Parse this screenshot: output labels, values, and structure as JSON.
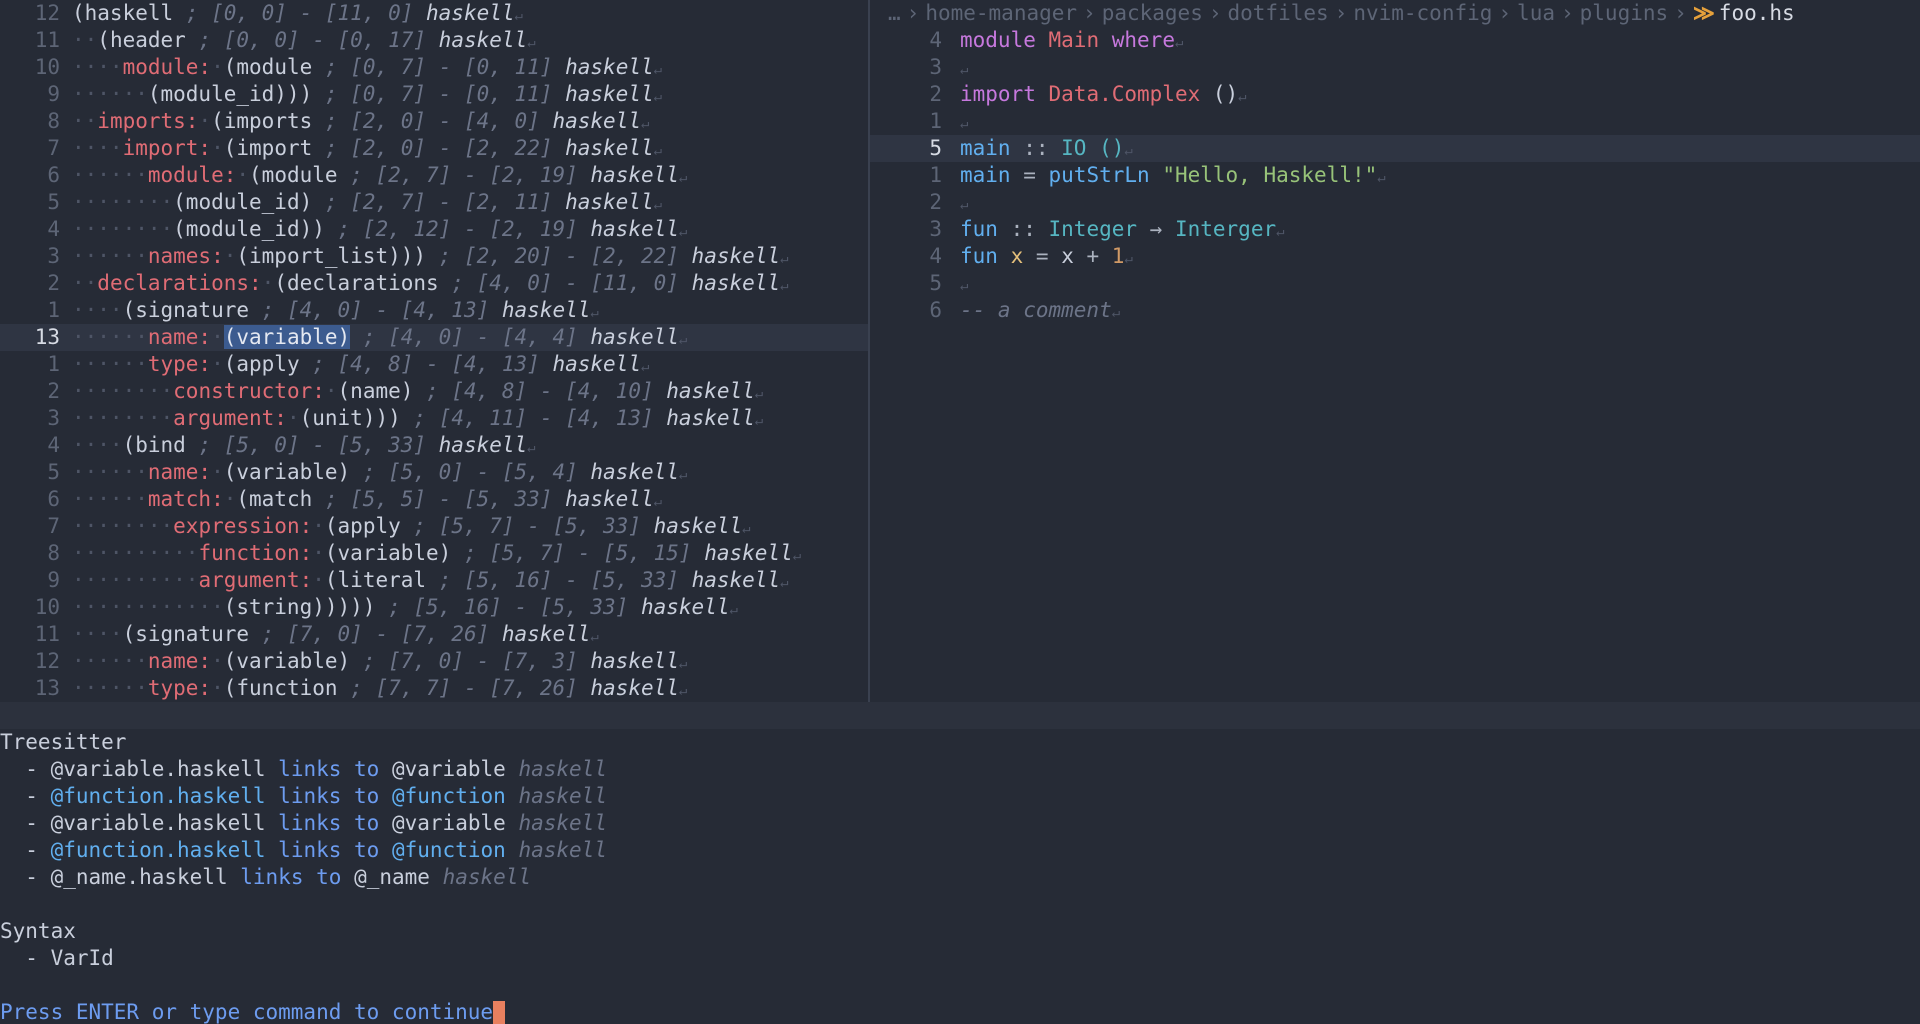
{
  "tree_lines": [
    {
      "num": "12",
      "lead": "",
      "field": "",
      "node": "(haskell",
      "range": " ; [0, 0] - [11, 0]",
      "lang": " haskell"
    },
    {
      "num": "11",
      "lead": "··",
      "field": "",
      "node": "(header",
      "range": " ; [0, 0] - [0, 17]",
      "lang": " haskell"
    },
    {
      "num": "10",
      "lead": "····",
      "field": "module: ",
      "node": "(module",
      "range": " ; [0, 7] - [0, 11]",
      "lang": " haskell"
    },
    {
      "num": "9",
      "lead": "······",
      "field": "",
      "node": "(module_id)))",
      "range": " ; [0, 7] - [0, 11]",
      "lang": " haskell"
    },
    {
      "num": "8",
      "lead": "··",
      "field": "imports: ",
      "node": "(imports",
      "range": " ; [2, 0] - [4, 0]",
      "lang": " haskell"
    },
    {
      "num": "7",
      "lead": "····",
      "field": "import: ",
      "node": "(import",
      "range": " ; [2, 0] - [2, 22]",
      "lang": " haskell"
    },
    {
      "num": "6",
      "lead": "······",
      "field": "module: ",
      "node": "(module",
      "range": " ; [2, 7] - [2, 19]",
      "lang": " haskell"
    },
    {
      "num": "5",
      "lead": "········",
      "field": "",
      "node": "(module_id)",
      "range": " ; [2, 7] - [2, 11]",
      "lang": " haskell"
    },
    {
      "num": "4",
      "lead": "········",
      "field": "",
      "node": "(module_id))",
      "range": " ; [2, 12] - [2, 19]",
      "lang": " haskell"
    },
    {
      "num": "3",
      "lead": "······",
      "field": "names: ",
      "node": "(import_list)))",
      "range": " ; [2, 20] - [2, 22]",
      "lang": " haskell"
    },
    {
      "num": "2",
      "lead": "··",
      "field": "declarations: ",
      "node": "(declarations",
      "range": " ; [4, 0] - [11, 0]",
      "lang": " haskell"
    },
    {
      "num": "1",
      "lead": "····",
      "field": "",
      "node": "(signature",
      "range": " ; [4, 0] - [4, 13]",
      "lang": " haskell"
    },
    {
      "num": "13",
      "lead": "······",
      "field": "name: ",
      "node": "(variable)",
      "range": " ; [4, 0] - [4, 4]",
      "lang": " haskell",
      "current": true
    },
    {
      "num": "1",
      "lead": "······",
      "field": "type: ",
      "node": "(apply",
      "range": " ; [4, 8] - [4, 13]",
      "lang": " haskell"
    },
    {
      "num": "2",
      "lead": "········",
      "field": "constructor: ",
      "node": "(name)",
      "range": " ; [4, 8] - [4, 10]",
      "lang": " haskell"
    },
    {
      "num": "3",
      "lead": "········",
      "field": "argument: ",
      "node": "(unit)))",
      "range": " ; [4, 11] - [4, 13]",
      "lang": " haskell"
    },
    {
      "num": "4",
      "lead": "····",
      "field": "",
      "node": "(bind",
      "range": " ; [5, 0] - [5, 33]",
      "lang": " haskell"
    },
    {
      "num": "5",
      "lead": "······",
      "field": "name: ",
      "node": "(variable)",
      "range": " ; [5, 0] - [5, 4]",
      "lang": " haskell"
    },
    {
      "num": "6",
      "lead": "······",
      "field": "match: ",
      "node": "(match",
      "range": " ; [5, 5] - [5, 33]",
      "lang": " haskell"
    },
    {
      "num": "7",
      "lead": "········",
      "field": "expression: ",
      "node": "(apply",
      "range": " ; [5, 7] - [5, 33]",
      "lang": " haskell"
    },
    {
      "num": "8",
      "lead": "··········",
      "field": "function: ",
      "node": "(variable)",
      "range": " ; [5, 7] - [5, 15]",
      "lang": " haskell"
    },
    {
      "num": "9",
      "lead": "··········",
      "field": "argument: ",
      "node": "(literal",
      "range": " ; [5, 16] - [5, 33]",
      "lang": " haskell"
    },
    {
      "num": "10",
      "lead": "············",
      "field": "",
      "node": "(string)))))",
      "range": " ; [5, 16] - [5, 33]",
      "lang": " haskell"
    },
    {
      "num": "11",
      "lead": "····",
      "field": "",
      "node": "(signature",
      "range": " ; [7, 0] - [7, 26]",
      "lang": " haskell"
    },
    {
      "num": "12",
      "lead": "······",
      "field": "name: ",
      "node": "(variable)",
      "range": " ; [7, 0] - [7, 3]",
      "lang": " haskell"
    },
    {
      "num": "13",
      "lead": "······",
      "field": "type: ",
      "node": "(function",
      "range": " ; [7, 7] - [7, 26]",
      "lang": " haskell"
    }
  ],
  "breadcrumb": {
    "ellipsis": "…",
    "items": [
      "home-manager",
      "packages",
      "dotfiles",
      "nvim-config",
      "lua",
      "plugins"
    ],
    "file": "foo.hs",
    "file_icon": "haskell-icon"
  },
  "code_lines": [
    {
      "num": "4",
      "tokens": [
        {
          "t": "module",
          "c": "kw"
        },
        {
          "t": " ",
          "c": "plain"
        },
        {
          "t": "Main",
          "c": "ty"
        },
        {
          "t": " ",
          "c": "plain"
        },
        {
          "t": "where",
          "c": "kw"
        }
      ]
    },
    {
      "num": "3",
      "tokens": []
    },
    {
      "num": "2",
      "tokens": [
        {
          "t": "import",
          "c": "kw"
        },
        {
          "t": " ",
          "c": "plain"
        },
        {
          "t": "Data.Complex",
          "c": "ty"
        },
        {
          "t": " ()",
          "c": "plain"
        }
      ]
    },
    {
      "num": "1",
      "tokens": []
    },
    {
      "num": "5",
      "current": true,
      "tokens": [
        {
          "t": "main",
          "c": "fn"
        },
        {
          "t": " :: ",
          "c": "op"
        },
        {
          "t": "IO",
          "c": "cy"
        },
        {
          "t": " ",
          "c": "plain"
        },
        {
          "t": "()",
          "c": "cy"
        }
      ]
    },
    {
      "num": "1",
      "tokens": [
        {
          "t": "main",
          "c": "fn"
        },
        {
          "t": " = ",
          "c": "op"
        },
        {
          "t": "putStrLn",
          "c": "fn"
        },
        {
          "t": " ",
          "c": "plain"
        },
        {
          "t": "\"Hello, Haskell!\"",
          "c": "str"
        }
      ]
    },
    {
      "num": "2",
      "tokens": []
    },
    {
      "num": "3",
      "tokens": [
        {
          "t": "fun",
          "c": "fn"
        },
        {
          "t": " :: ",
          "c": "op"
        },
        {
          "t": "Integer",
          "c": "cy"
        },
        {
          "t": " → ",
          "c": "op"
        },
        {
          "t": "Interger",
          "c": "cy"
        }
      ]
    },
    {
      "num": "4",
      "tokens": [
        {
          "t": "fun",
          "c": "fn"
        },
        {
          "t": " ",
          "c": "plain"
        },
        {
          "t": "x",
          "c": "var"
        },
        {
          "t": " = ",
          "c": "op"
        },
        {
          "t": "x",
          "c": "plain"
        },
        {
          "t": " + ",
          "c": "op"
        },
        {
          "t": "1",
          "c": "num"
        }
      ]
    },
    {
      "num": "5",
      "tokens": []
    },
    {
      "num": "6",
      "tokens": [
        {
          "t": "-- a comment",
          "c": "cmt"
        }
      ]
    }
  ],
  "messages": {
    "treesitter_title": "Treesitter",
    "treesitter_items": [
      {
        "from": "@variable.haskell",
        "links": "links to",
        "to": "@variable",
        "lang": "haskell",
        "is_function": false
      },
      {
        "from": "@function.haskell",
        "links": "links to",
        "to": "@function",
        "lang": "haskell",
        "is_function": true
      },
      {
        "from": "@variable.haskell",
        "links": "links to",
        "to": "@variable",
        "lang": "haskell",
        "is_function": false
      },
      {
        "from": "@function.haskell",
        "links": "links to",
        "to": "@function",
        "lang": "haskell",
        "is_function": true
      },
      {
        "from": "@_name.haskell",
        "links": "links to",
        "to": "@_name",
        "lang": "haskell",
        "is_function": false
      }
    ],
    "syntax_title": "Syntax",
    "syntax_items": [
      "VarId"
    ],
    "prompt": "Press ENTER or type command to continue"
  },
  "glyphs": {
    "eol": "↵",
    "bullet": "- "
  },
  "colors": {
    "background": "#262b36",
    "selection": "#3c5b8f",
    "field": "#e06c75",
    "cursor": "#e8805f"
  }
}
